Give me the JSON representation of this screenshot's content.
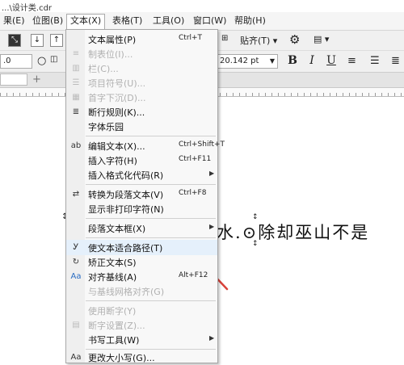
{
  "title": "...\\设计类.cdr",
  "menubar": {
    "items": [
      {
        "label": "果(E)"
      },
      {
        "label": "位图(B)"
      },
      {
        "label": "文本(X)"
      },
      {
        "label": "表格(T)"
      },
      {
        "label": "工具(O)"
      },
      {
        "label": "窗口(W)"
      },
      {
        "label": "帮助(H)"
      }
    ]
  },
  "toolbar": {
    "align_label": "贴齐(T)",
    "font_size_value": "20.142 pt",
    "zoom_value": ".0",
    "bold": "B",
    "italic": "I",
    "underline": "U"
  },
  "menu": {
    "items": [
      {
        "label": "文本属性(P)",
        "shortcut": "Ctrl+T",
        "enabled": true,
        "icon": "text-properties-icon"
      },
      {
        "label": "制表位(I)...",
        "shortcut": "",
        "enabled": false,
        "icon": "tab-stops-icon"
      },
      {
        "label": "栏(C)...",
        "shortcut": "",
        "enabled": false,
        "icon": "columns-icon"
      },
      {
        "label": "项目符号(U)...",
        "shortcut": "",
        "enabled": false,
        "icon": "bullets-icon"
      },
      {
        "label": "首字下沉(D)...",
        "shortcut": "",
        "enabled": false,
        "icon": "drop-cap-icon"
      },
      {
        "label": "断行规则(K)...",
        "shortcut": "",
        "enabled": true,
        "icon": "line-break-icon"
      },
      {
        "label": "字体乐园",
        "shortcut": "",
        "enabled": true,
        "icon": ""
      },
      {
        "label": "编辑文本(X)...",
        "shortcut": "Ctrl+Shift+T",
        "enabled": true,
        "icon": "edit-text-icon"
      },
      {
        "label": "插入字符(H)",
        "shortcut": "Ctrl+F11",
        "enabled": true,
        "icon": ""
      },
      {
        "label": "插入格式化代码(R)",
        "shortcut": "",
        "enabled": true,
        "icon": "",
        "submenu": true
      },
      {
        "label": "转换为段落文本(V)",
        "shortcut": "Ctrl+F8",
        "enabled": true,
        "icon": "convert-paragraph-icon"
      },
      {
        "label": "显示非打印字符(N)",
        "shortcut": "",
        "enabled": true,
        "icon": ""
      },
      {
        "label": "段落文本框(X)",
        "shortcut": "",
        "enabled": true,
        "icon": "",
        "submenu": true
      },
      {
        "label": "使文本适合路径(T)",
        "shortcut": "",
        "enabled": true,
        "icon": "fit-text-path-icon"
      },
      {
        "label": "矫正文本(S)",
        "shortcut": "",
        "enabled": true,
        "icon": "straighten-text-icon"
      },
      {
        "label": "对齐基线(A)",
        "shortcut": "Alt+F12",
        "enabled": true,
        "icon": "align-baseline-icon"
      },
      {
        "label": "与基线网格对齐(G)",
        "shortcut": "",
        "enabled": false,
        "icon": ""
      },
      {
        "label": "使用断字(Y)",
        "shortcut": "",
        "enabled": false,
        "icon": ""
      },
      {
        "label": "断字设置(Z)...",
        "shortcut": "",
        "enabled": false,
        "icon": "hyphenation-icon"
      },
      {
        "label": "书写工具(W)",
        "shortcut": "",
        "enabled": true,
        "icon": "",
        "submenu": true
      },
      {
        "label": "更改大小写(G)...",
        "shortcut": "",
        "enabled": true,
        "icon": "change-case-icon"
      }
    ]
  },
  "canvas_text": "水.⊙除却巫山不是"
}
